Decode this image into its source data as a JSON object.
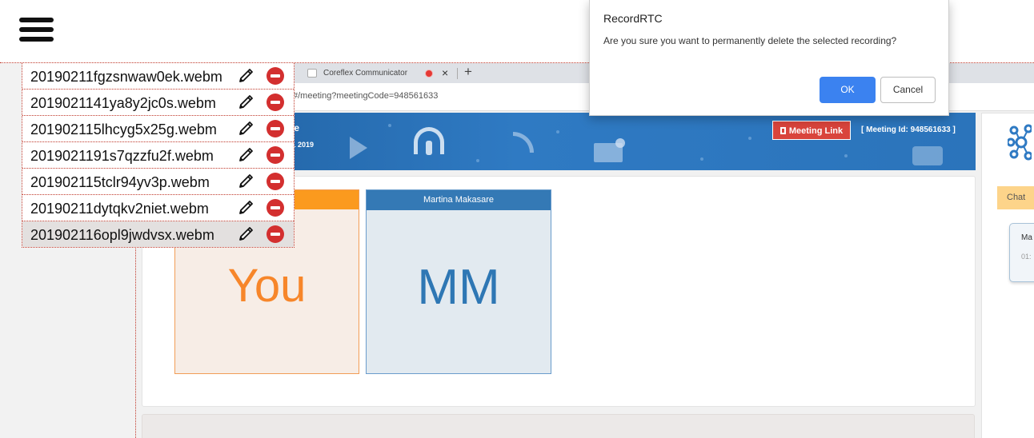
{
  "header": {
    "menu_icon": "hamburger-menu-icon"
  },
  "browser": {
    "tab_title": "Coreflex Communicator",
    "tab_close": "×",
    "new_tab": "+",
    "url": "#/meeting?meetingCode=948561633"
  },
  "banner": {
    "name_fragment": "ne",
    "date_fragment": "11 2019",
    "meeting_link_label": "Meeting Link",
    "meeting_id_label": "[ Meeting Id: 948561633 ]",
    "icons": [
      "play-icon",
      "headset-icon",
      "wifi-icon",
      "mail-icon",
      "chat-icon"
    ]
  },
  "tiles": [
    {
      "header": "",
      "initials": "You",
      "accent": "#fb9a1e"
    },
    {
      "header": "Martina Makasare",
      "initials": "MM",
      "accent": "#3479b5"
    }
  ],
  "right_panel": {
    "chat_tab_label": "Chat",
    "card_name": "Ma",
    "card_time": "01:"
  },
  "recordings": [
    {
      "name": "20190211fgzsnwaw0ek.webm",
      "selected": false
    },
    {
      "name": "2019021141ya8y2jc0s.webm",
      "selected": false
    },
    {
      "name": "201902115lhcyg5x25g.webm",
      "selected": false
    },
    {
      "name": "2019021191s7qzzfu2f.webm",
      "selected": false
    },
    {
      "name": "201902115tclr94yv3p.webm",
      "selected": false
    },
    {
      "name": "20190211dytqkv2niet.webm",
      "selected": false
    },
    {
      "name": "201902116opl9jwdvsx.webm",
      "selected": true
    }
  ],
  "dialog": {
    "title": "RecordRTC",
    "message": "Are you sure you want to permanently delete the selected recording?",
    "ok_label": "OK",
    "cancel_label": "Cancel"
  },
  "colors": {
    "accent_blue": "#3b82f0",
    "delete_red": "#d32f2f",
    "banner_blue": "#2f7ac3",
    "you_orange": "#f7862a"
  }
}
